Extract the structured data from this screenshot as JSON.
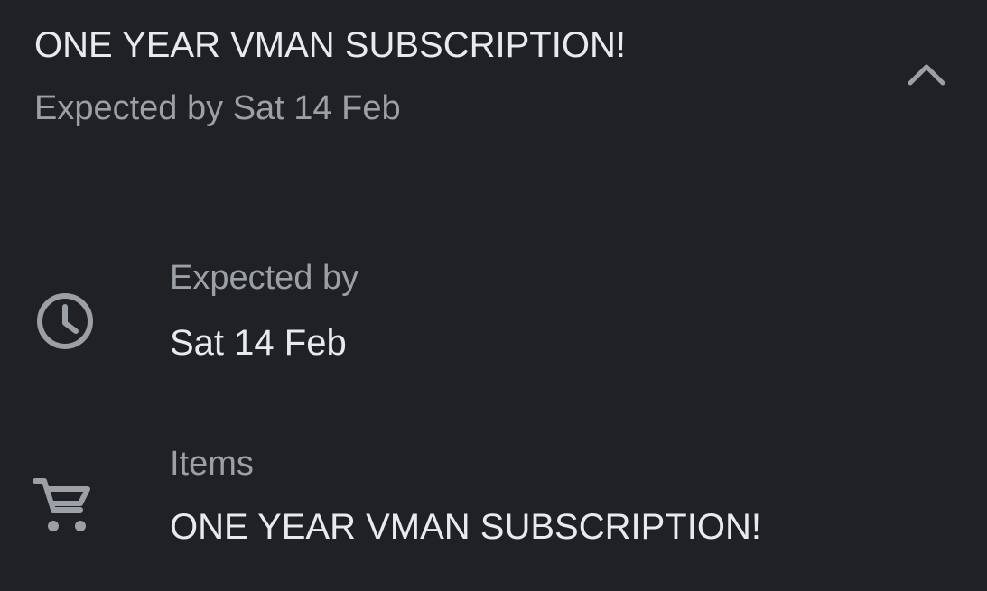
{
  "header": {
    "title": "ONE YEAR VMAN SUBSCRIPTION!",
    "subtitle": "Expected by Sat 14 Feb",
    "collapse_icon": "chevron-up-icon"
  },
  "details": {
    "expected": {
      "icon": "clock-icon",
      "label": "Expected by",
      "value": "Sat 14 Feb"
    },
    "items": {
      "icon": "shopping-cart-icon",
      "label": "Items",
      "value": "ONE YEAR VMAN SUBSCRIPTION!"
    }
  },
  "colors": {
    "background": "#202124",
    "primary_text": "#e8eaed",
    "secondary_text": "#9aa0a6"
  }
}
